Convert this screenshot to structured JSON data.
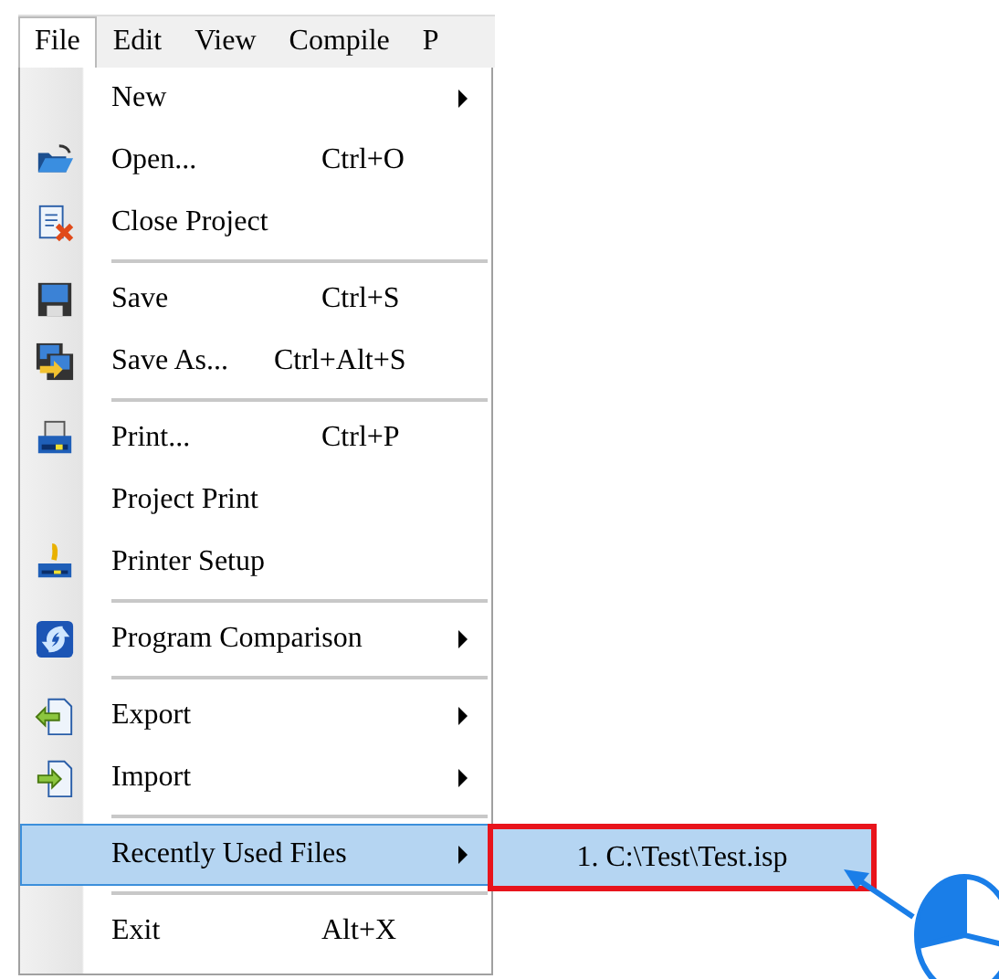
{
  "menu_bar": [
    {
      "label": "File",
      "selected": true
    },
    {
      "label": "Edit",
      "selected": false
    },
    {
      "label": "View",
      "selected": false
    },
    {
      "label": "Compile",
      "selected": false
    },
    {
      "label": "P",
      "selected": false
    }
  ],
  "file_menu": [
    {
      "kind": "item",
      "label": "New",
      "submenu": true,
      "selected": false
    },
    {
      "kind": "item",
      "label": "Open...",
      "shortcut": "Ctrl+O",
      "submenu": false,
      "selected": false
    },
    {
      "kind": "item",
      "label": "Close Project",
      "submenu": false,
      "selected": false
    },
    {
      "kind": "separator"
    },
    {
      "kind": "item",
      "label": "Save",
      "shortcut": "Ctrl+S",
      "submenu": false,
      "selected": false
    },
    {
      "kind": "item",
      "label": "Save As...",
      "shortcut": "Ctrl+Alt+S",
      "submenu": false,
      "selected": false
    },
    {
      "kind": "separator"
    },
    {
      "kind": "item",
      "label": "Print...",
      "shortcut": "Ctrl+P",
      "submenu": false,
      "selected": false
    },
    {
      "kind": "item",
      "label": "Project Print",
      "submenu": false,
      "selected": false
    },
    {
      "kind": "item",
      "label": "Printer Setup",
      "submenu": false,
      "selected": false
    },
    {
      "kind": "separator"
    },
    {
      "kind": "item",
      "label": "Program Comparison",
      "submenu": true,
      "selected": false
    },
    {
      "kind": "separator"
    },
    {
      "kind": "item",
      "label": "Export",
      "submenu": true,
      "selected": false
    },
    {
      "kind": "item",
      "label": "Import",
      "submenu": true,
      "selected": false
    },
    {
      "kind": "separator"
    },
    {
      "kind": "item",
      "label": "Recently Used Files",
      "submenu": true,
      "selected": true
    },
    {
      "kind": "separator"
    },
    {
      "kind": "item",
      "label": "Exit",
      "shortcut": "Alt+X",
      "submenu": false,
      "selected": false
    }
  ],
  "recent_files_submenu": [
    {
      "label": "1. C:\\Test\\Test.isp",
      "selected": true,
      "highlighted": true
    }
  ]
}
